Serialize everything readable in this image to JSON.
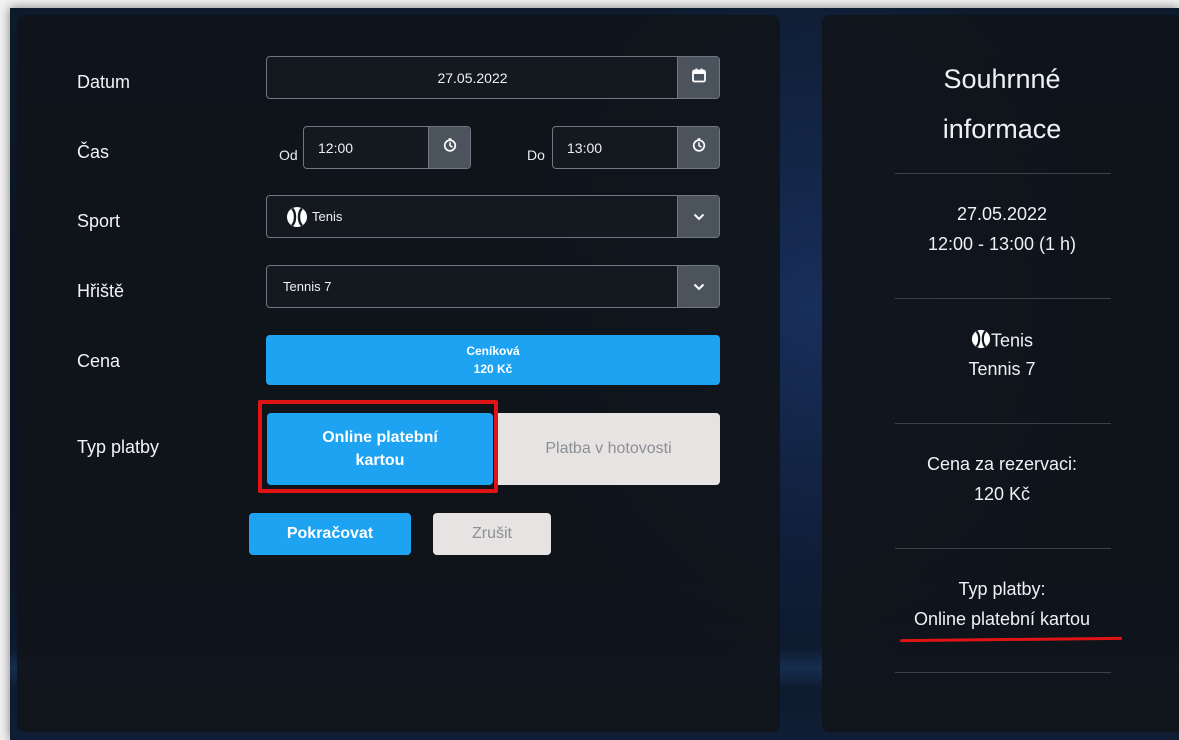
{
  "form": {
    "date_label": "Datum",
    "date_value": "27.05.2022",
    "time_label": "Čas",
    "from_label": "Od",
    "from_value": "12:00",
    "to_label": "Do",
    "to_value": "13:00",
    "sport_label": "Sport",
    "sport_value": "Tenis",
    "court_label": "Hřiště",
    "court_value": "Tennis 7",
    "price_label": "Cena",
    "price_type": "Ceníková",
    "price_value": "120 Kč",
    "payment_label": "Typ platby",
    "payment_online": "Online platební kartou",
    "payment_cash": "Platba v hotovosti",
    "continue_label": "Pokračovat",
    "cancel_label": "Zrušit"
  },
  "summary": {
    "title_line1": "Souhrnné",
    "title_line2": "informace",
    "date": "27.05.2022",
    "time": "12:00 - 13:00 (1 h)",
    "sport": "Tenis",
    "court": "Tennis 7",
    "price_label": "Cena za rezervaci:",
    "price_value": "120 Kč",
    "payment_label": "Typ platby:",
    "payment_value": "Online platební kartou"
  },
  "colors": {
    "accent": "#1ea3f3",
    "highlight": "#e01414",
    "panel": "#10141b"
  },
  "icons": {
    "date": "calendar-icon",
    "time": "clock-icon",
    "sport": "tennis-ball-icon",
    "dropdown": "chevron-down-icon"
  }
}
